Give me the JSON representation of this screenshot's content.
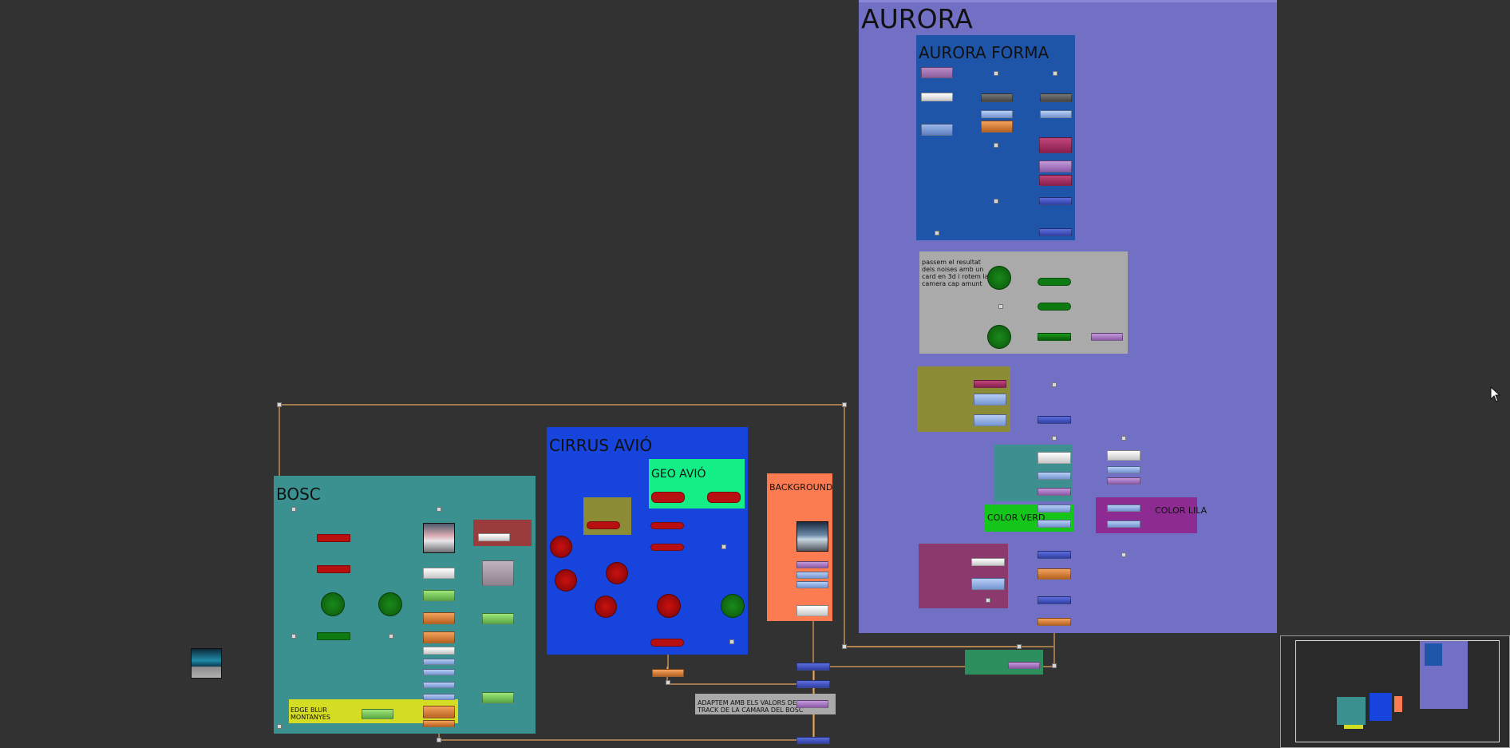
{
  "backdrops": {
    "aurora": {
      "label": "AURORA",
      "color": "#7170c4"
    },
    "aurora_forma": {
      "label": "AURORA FORMA",
      "color": "#1f55a8"
    },
    "cirrus_avio": {
      "label": "CIRRUS AVIÓ",
      "color": "#1744dc"
    },
    "geo_avio": {
      "label": "GEO AVIÓ",
      "color": "#13ee86"
    },
    "bosc": {
      "label": "BOSC",
      "color": "#3a918f"
    },
    "background": {
      "label": "BACKGROUND",
      "color": "#fd7b50"
    },
    "color_verd": {
      "label": "COLOR VERD",
      "color": "#15c51a"
    },
    "color_lila": {
      "label": "COLOR LILA",
      "color": "#8e2b93"
    },
    "edge_blur": {
      "label": "EDGE BLUR\nMONTANYES",
      "color": "#d5dc24"
    },
    "noises_note": {
      "label": "passem el resultat\ndels noises amb un\ncard en 3d i rotem la\ncamera cap amunt",
      "color": "#aaaaaa"
    },
    "track_note": {
      "label": "ADAPTEM AMB ELS VALORS DEL\nTRACK DE LA CAMARA DEL BOSC",
      "color": "#a9a9a9"
    }
  },
  "icons": {
    "cursor": "mouse-pointer-icon",
    "viewer": "viewer-icon"
  },
  "colors": {
    "canvas": "#323232",
    "wire": "#e6a45a",
    "wire_dark": "#111111",
    "merge_node": "#4a5bd0",
    "grade_node": "#8c3a6e",
    "transform_node": "#9bb6e6",
    "read_node": "#d87a3e",
    "scanline_pill": "#b81010",
    "card_pill": "#0d7a12"
  }
}
